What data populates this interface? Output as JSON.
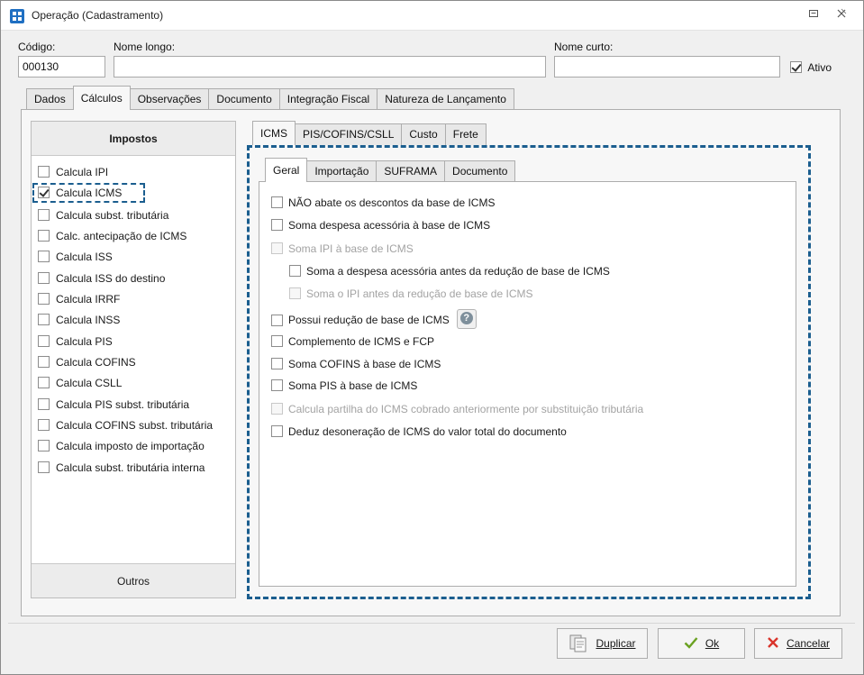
{
  "window": {
    "title": "Operação (Cadastramento)"
  },
  "form": {
    "codigo_label": "Código:",
    "codigo_value": "000130",
    "nome_longo_label": "Nome longo:",
    "nome_longo_value": "",
    "nome_curto_label": "Nome curto:",
    "nome_curto_value": "",
    "ativo_label": "Ativo",
    "ativo_checked": true
  },
  "main_tabs": [
    "Dados",
    "Cálculos",
    "Observações",
    "Documento",
    "Integração Fiscal",
    "Natureza de Lançamento"
  ],
  "main_tab_active": "Cálculos",
  "impostos": {
    "header": "Impostos",
    "footer": "Outros",
    "items": [
      {
        "label": "Calcula IPI",
        "checked": false
      },
      {
        "label": "Calcula ICMS",
        "checked": true
      },
      {
        "label": "Calcula subst. tributária",
        "checked": false
      },
      {
        "label": "Calc. antecipação de ICMS",
        "checked": false
      },
      {
        "label": "Calcula ISS",
        "checked": false
      },
      {
        "label": "Calcula ISS do destino",
        "checked": false
      },
      {
        "label": "Calcula IRRF",
        "checked": false
      },
      {
        "label": "Calcula INSS",
        "checked": false
      },
      {
        "label": "Calcula PIS",
        "checked": false
      },
      {
        "label": "Calcula COFINS",
        "checked": false
      },
      {
        "label": "Calcula CSLL",
        "checked": false
      },
      {
        "label": "Calcula PIS subst. tributária",
        "checked": false
      },
      {
        "label": "Calcula COFINS subst. tributária",
        "checked": false
      },
      {
        "label": "Calcula imposto de importação",
        "checked": false
      },
      {
        "label": "Calcula subst. tributária interna",
        "checked": false
      }
    ]
  },
  "sub_tabs": [
    "ICMS",
    "PIS/COFINS/CSLL",
    "Custo",
    "Frete"
  ],
  "sub_tab_active": "ICMS",
  "icms_tabs": [
    "Geral",
    "Importação",
    "SUFRAMA",
    "Documento"
  ],
  "icms_tab_active": "Geral",
  "icms_options": [
    {
      "label": "NÃO abate os descontos da base de ICMS",
      "checked": false,
      "disabled": false
    },
    {
      "label": "Soma despesa acessória à base de ICMS",
      "checked": false,
      "disabled": false
    },
    {
      "label": "Soma IPI à base de ICMS",
      "checked": false,
      "disabled": true
    },
    {
      "label": "Soma a despesa acessória antes da redução de base de ICMS",
      "checked": false,
      "disabled": false
    },
    {
      "label": "Soma o IPI antes da redução de base de ICMS",
      "checked": false,
      "disabled": true
    },
    {
      "label": "Possui redução de base de ICMS",
      "checked": false,
      "disabled": false,
      "help": "help-icon"
    },
    {
      "label": "Complemento de ICMS e FCP",
      "checked": false,
      "disabled": false
    },
    {
      "label": "Soma COFINS à base de ICMS",
      "checked": false,
      "disabled": false
    },
    {
      "label": "Soma PIS à base de ICMS",
      "checked": false,
      "disabled": false
    },
    {
      "label": "Calcula partilha do ICMS cobrado anteriormente por substituição tributária",
      "checked": false,
      "disabled": true
    },
    {
      "label": "Deduz desoneração de ICMS do valor total do documento",
      "checked": false,
      "disabled": false
    }
  ],
  "buttons": {
    "duplicar": "Duplicar",
    "ok": "Ok",
    "cancelar": "Cancelar"
  },
  "colors": {
    "accent_dashed": "#1b5e8f",
    "ok_green": "#6aa121",
    "cancel_red": "#d9342b"
  }
}
